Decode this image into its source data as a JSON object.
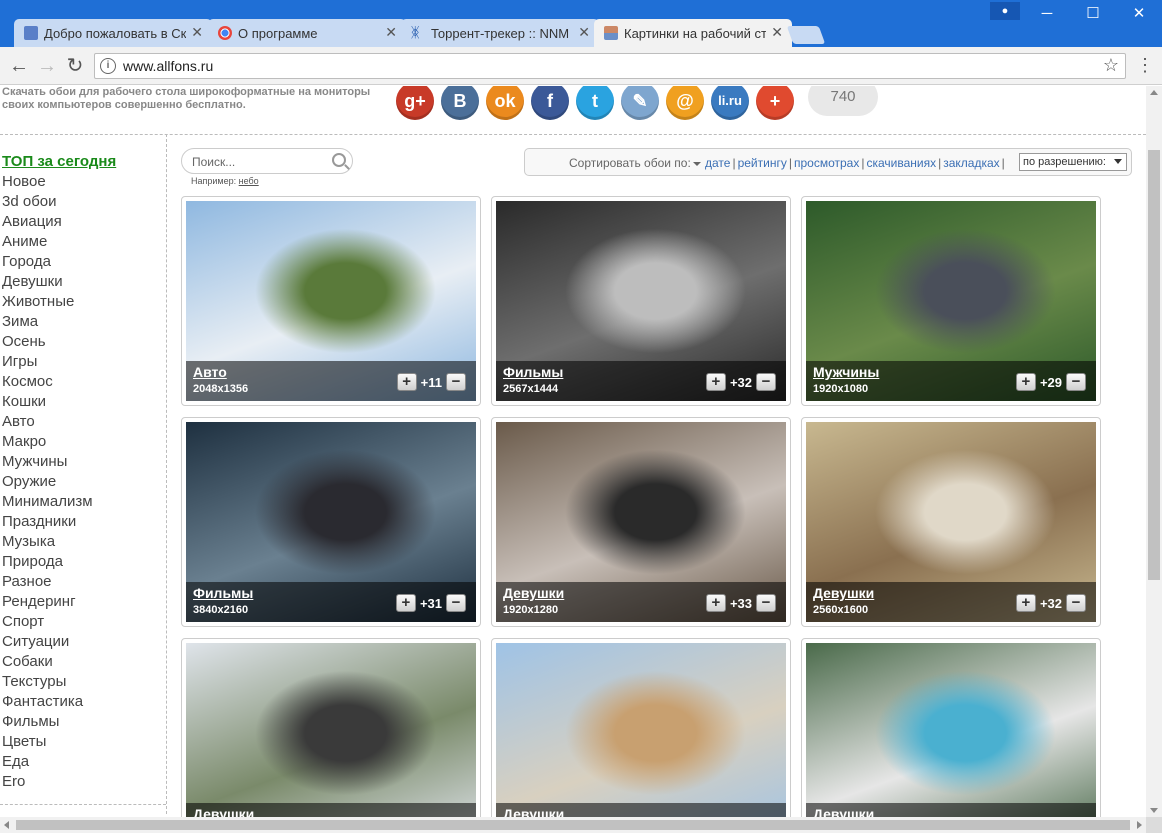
{
  "browser": {
    "tabs": [
      {
        "title": "Добро пожаловать в Ск",
        "favicon": "page-icon",
        "color": "#5a7fc8"
      },
      {
        "title": "О программе",
        "favicon": "chrome-icon",
        "color": "#4285f4"
      },
      {
        "title": "Торрент-трекер :: NNM",
        "favicon": "butterfly-icon",
        "color": "#2a5fb0"
      },
      {
        "title": "Картинки на рабочий ст",
        "favicon": "image-icon",
        "color": "#b44"
      }
    ],
    "active_tab": 3,
    "url": "www.allfons.ru"
  },
  "intro_text": "Скачать обои для рабочего стола широкоформатные на мониторы своих компьютеров совершенно бесплатно.",
  "social": {
    "buttons": [
      {
        "label": "g+",
        "name": "google-plus-icon",
        "color": "#c83a28"
      },
      {
        "label": "B",
        "name": "vk-icon",
        "color": "#4b6f99"
      },
      {
        "label": "ok",
        "name": "odnoklassniki-icon",
        "color": "#eb8a1e"
      },
      {
        "label": "f",
        "name": "facebook-icon",
        "color": "#3b5998"
      },
      {
        "label": "t",
        "name": "twitter-icon",
        "color": "#2aa3e0"
      },
      {
        "label": "✎",
        "name": "livejournal-icon",
        "color": "#7ea6cf"
      },
      {
        "label": "@",
        "name": "mail-icon",
        "color": "#f0a020"
      },
      {
        "label": "li.ru",
        "name": "liveinternet-icon",
        "color": "#3a7ac0"
      },
      {
        "label": "+",
        "name": "more-share-icon",
        "color": "#e04a2f"
      }
    ],
    "count": "740"
  },
  "sidebar": {
    "top_link": "ТОП за сегодня",
    "categories": [
      "Новое",
      "3d обои",
      "Авиация",
      "Аниме",
      "Города",
      "Девушки",
      "Животные",
      "Зима",
      "Осень",
      "Игры",
      "Космос",
      "Кошки",
      "Авто",
      "Макро",
      "Мужчины",
      "Оружие",
      "Минимализм",
      "Праздники",
      "Музыка",
      "Природа",
      "Разное",
      "Рендеринг",
      "Спорт",
      "Ситуации",
      "Собаки",
      "Текстуры",
      "Фантастика",
      "Фильмы",
      "Цветы",
      "Еда",
      "Ero"
    ]
  },
  "search": {
    "placeholder": "Поиск...",
    "example_prefix": "Например:",
    "example_link": "небо"
  },
  "sort": {
    "label": "Сортировать обои по:",
    "options": [
      "дате",
      "рейтингу",
      "просмотрах",
      "скачиваниях",
      "закладках"
    ],
    "resolution_select": "по разрешению:"
  },
  "wallpapers": [
    {
      "category": "Авто",
      "resolution": "2048x1356",
      "votes": "+11",
      "palette": [
        "#8fb8e0",
        "#e8eef4",
        "#5a7a3a"
      ]
    },
    {
      "category": "Фильмы",
      "resolution": "2567x1444",
      "votes": "+32",
      "palette": [
        "#2a2a2a",
        "#6e6e6e",
        "#bdbdbd"
      ]
    },
    {
      "category": "Мужчины",
      "resolution": "1920x1080",
      "votes": "+29",
      "palette": [
        "#2d5a2a",
        "#6a8a4a",
        "#4a4f5a"
      ]
    },
    {
      "category": "Фильмы",
      "resolution": "3840x2160",
      "votes": "+31",
      "palette": [
        "#1e3040",
        "#6a8090",
        "#2a2a30"
      ]
    },
    {
      "category": "Девушки",
      "resolution": "1920x1280",
      "votes": "+33",
      "palette": [
        "#6a5a4a",
        "#c8bfb8",
        "#2a2a2a"
      ]
    },
    {
      "category": "Девушки",
      "resolution": "2560x1600",
      "votes": "+32",
      "palette": [
        "#c8b890",
        "#8a7050",
        "#e0d8c8"
      ]
    },
    {
      "category": "Девушки",
      "resolution": "",
      "votes": "",
      "palette": [
        "#dfe4ea",
        "#7a8a6a",
        "#3a3a3a"
      ]
    },
    {
      "category": "Девушки",
      "resolution": "",
      "votes": "",
      "palette": [
        "#9fc3e6",
        "#d8d0c0",
        "#c8a070"
      ]
    },
    {
      "category": "Девушки",
      "resolution": "",
      "votes": "",
      "palette": [
        "#4a6a4a",
        "#e6e6e6",
        "#4ab0d0"
      ]
    }
  ]
}
